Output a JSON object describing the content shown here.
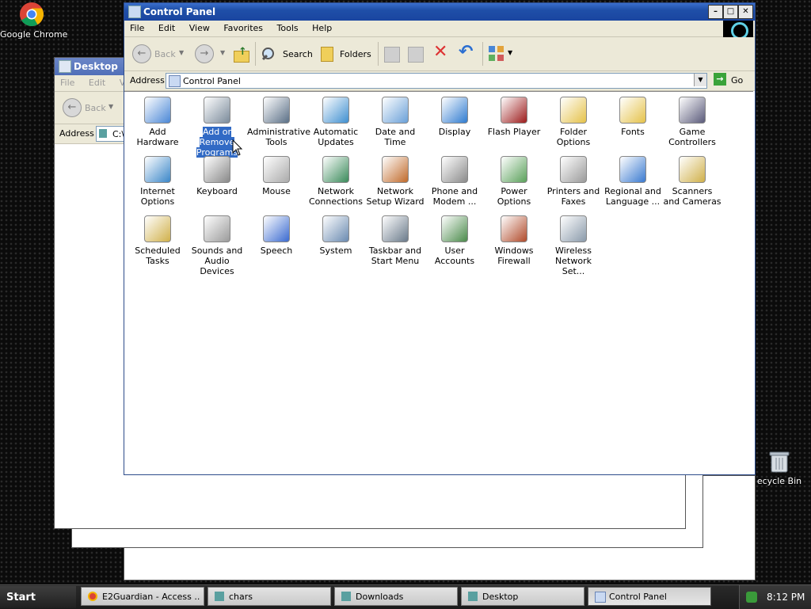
{
  "desktop": {
    "icons": [
      {
        "label": "Google Chrome"
      },
      {
        "label": "ecycle Bin"
      }
    ]
  },
  "bg_windows": {
    "desktop": {
      "title": "Desktop",
      "menu": [
        "File",
        "Edit",
        "Vi"
      ],
      "back_label": "Back",
      "address_label": "Address",
      "address_value": "C:\\"
    }
  },
  "control_panel": {
    "title": "Control Panel",
    "menu": [
      "File",
      "Edit",
      "View",
      "Favorites",
      "Tools",
      "Help"
    ],
    "toolbar": {
      "back": "Back",
      "search": "Search",
      "folders": "Folders"
    },
    "address_label": "Address",
    "address_value": "Control Panel",
    "go_label": "Go",
    "items": [
      {
        "label": "Add Hardware",
        "icon": "add-hardware-icon"
      },
      {
        "label": "Add or Remove Programs",
        "icon": "add-remove-programs-icon",
        "selected": true
      },
      {
        "label": "Administrative Tools",
        "icon": "admin-tools-icon"
      },
      {
        "label": "Automatic Updates",
        "icon": "automatic-updates-icon"
      },
      {
        "label": "Date and Time",
        "icon": "date-time-icon"
      },
      {
        "label": "Display",
        "icon": "display-icon"
      },
      {
        "label": "Flash Player",
        "icon": "flash-player-icon"
      },
      {
        "label": "Folder Options",
        "icon": "folder-options-icon"
      },
      {
        "label": "Fonts",
        "icon": "fonts-icon"
      },
      {
        "label": "Game Controllers",
        "icon": "game-controllers-icon"
      },
      {
        "label": "Internet Options",
        "icon": "internet-options-icon"
      },
      {
        "label": "Keyboard",
        "icon": "keyboard-icon"
      },
      {
        "label": "Mouse",
        "icon": "mouse-icon"
      },
      {
        "label": "Network Connections",
        "icon": "network-connections-icon"
      },
      {
        "label": "Network Setup Wizard",
        "icon": "network-setup-icon"
      },
      {
        "label": "Phone and Modem ...",
        "icon": "phone-modem-icon"
      },
      {
        "label": "Power Options",
        "icon": "power-options-icon"
      },
      {
        "label": "Printers and Faxes",
        "icon": "printers-faxes-icon"
      },
      {
        "label": "Regional and Language ...",
        "icon": "regional-language-icon"
      },
      {
        "label": "Scanners and Cameras",
        "icon": "scanners-cameras-icon"
      },
      {
        "label": "Scheduled Tasks",
        "icon": "scheduled-tasks-icon"
      },
      {
        "label": "Sounds and Audio Devices",
        "icon": "sounds-audio-icon"
      },
      {
        "label": "Speech",
        "icon": "speech-icon"
      },
      {
        "label": "System",
        "icon": "system-icon"
      },
      {
        "label": "Taskbar and Start Menu",
        "icon": "taskbar-start-icon"
      },
      {
        "label": "User Accounts",
        "icon": "user-accounts-icon"
      },
      {
        "label": "Windows Firewall",
        "icon": "windows-firewall-icon"
      },
      {
        "label": "Wireless Network Set...",
        "icon": "wireless-network-icon"
      }
    ]
  },
  "taskbar": {
    "start": "Start",
    "tasks": [
      {
        "label": "E2Guardian - Access ..."
      },
      {
        "label": "chars"
      },
      {
        "label": "Downloads"
      },
      {
        "label": "Desktop"
      },
      {
        "label": "Control Panel",
        "active": true
      }
    ],
    "clock": "8:12 PM"
  }
}
